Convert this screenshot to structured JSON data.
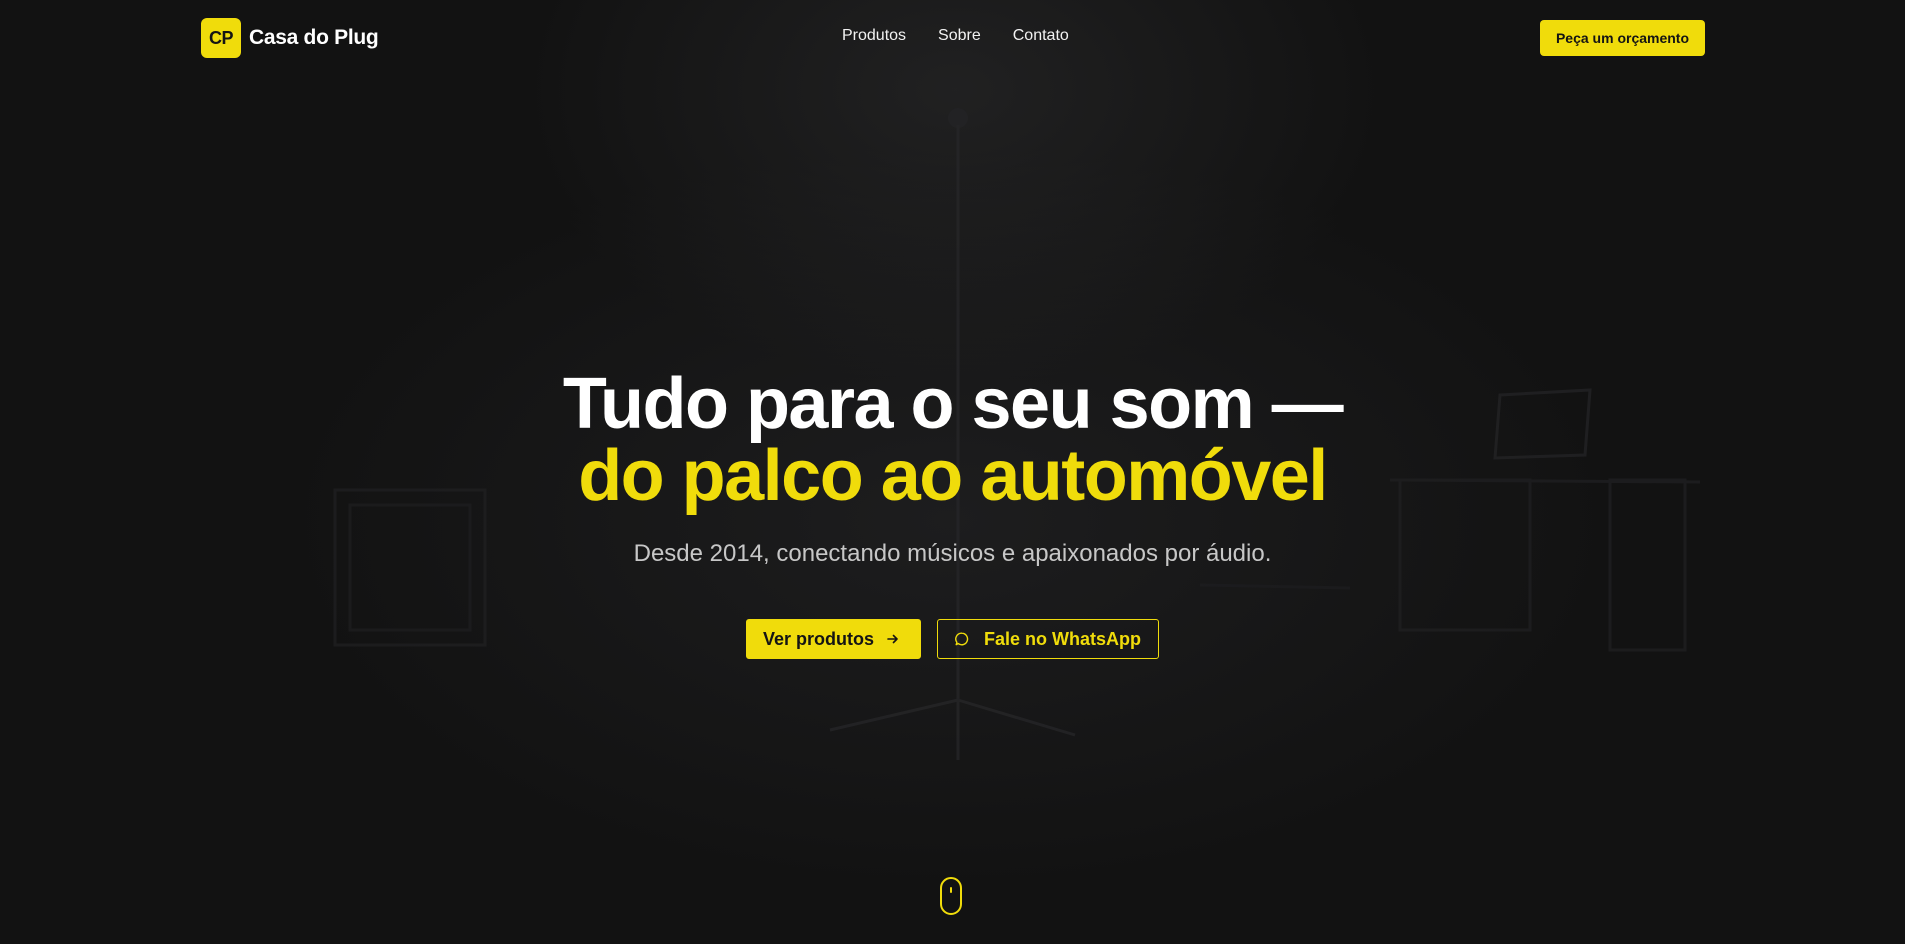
{
  "colors": {
    "accent": "#f0dc0b",
    "background": "#121212",
    "text": "#ffffff",
    "muted": "#c7c7c7"
  },
  "header": {
    "logo_mark": "CP",
    "brand_name": "Casa do Plug",
    "nav": [
      {
        "label": "Produtos"
      },
      {
        "label": "Sobre"
      },
      {
        "label": "Contato"
      }
    ],
    "cta_label": "Peça um orçamento"
  },
  "hero": {
    "title_line1": "Tudo para o seu som —",
    "title_line2": "do palco ao automóvel",
    "subtitle": "Desde 2014, conectando músicos e apaixonados por áudio.",
    "primary_button": {
      "label": "Ver produtos",
      "icon": "arrow-right-icon"
    },
    "secondary_button": {
      "label": "Fale no WhatsApp",
      "icon": "chat-bubble-icon"
    }
  },
  "scroll_indicator": {
    "icon": "mouse-scroll-icon"
  }
}
